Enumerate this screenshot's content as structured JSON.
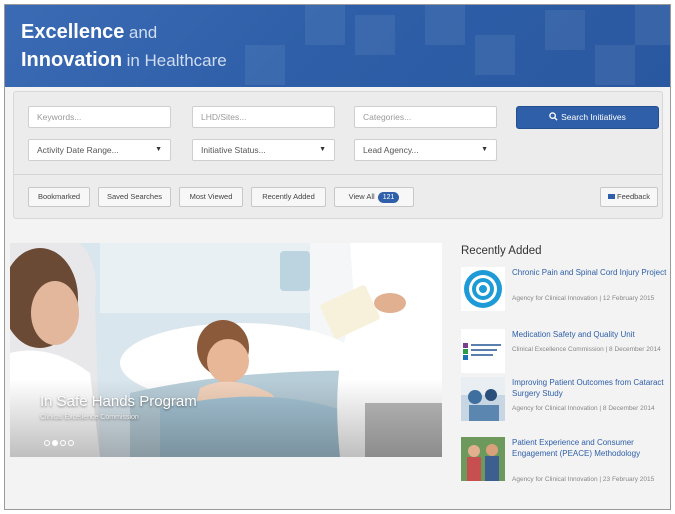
{
  "header": {
    "title_bold_1": "Excellence",
    "title_light_1": "and",
    "title_bold_2": "Innovation",
    "title_light_2": "in Healthcare"
  },
  "search": {
    "keywords_placeholder": "Keywords...",
    "lhd_placeholder": "LHD/Sites...",
    "categories_placeholder": "Categories...",
    "search_button": "Search Initiatives",
    "activity_date": "Activity Date Range...",
    "initiative_status": "Initiative Status...",
    "lead_agency": "Lead Agency..."
  },
  "filters": {
    "bookmarked": "Bookmarked",
    "saved_searches": "Saved Searches",
    "most_viewed": "Most Viewed",
    "recently_added": "Recently Added",
    "view_all": "View All",
    "view_all_count": "121",
    "feedback": "Feedback"
  },
  "hero": {
    "title": "In Safe Hands Program",
    "subtitle": "Clinical Excellence Commission",
    "slide_count": 4,
    "active_slide": 2
  },
  "recent": {
    "heading": "Recently Added",
    "items": [
      {
        "title": "Chronic Pain and Spinal Cord Injury Project",
        "meta": "Agency for Clinical Innovation | 12 February 2015"
      },
      {
        "title": "Medication Safety and Quality Unit",
        "meta": "Clinical Excellence Commission | 8 December 2014"
      },
      {
        "title": "Improving Patient Outcomes from Cataract Surgery Study",
        "meta": "Agency for Clinical Innovation | 8 December 2014"
      },
      {
        "title": "Patient Experience and Consumer Engagement (PEACE) Methodology",
        "meta": "Agency for Clinical Innovation | 23 February 2015"
      }
    ]
  },
  "colors": {
    "brand_blue": "#2e5fa8",
    "link_blue": "#2e5fa8"
  }
}
